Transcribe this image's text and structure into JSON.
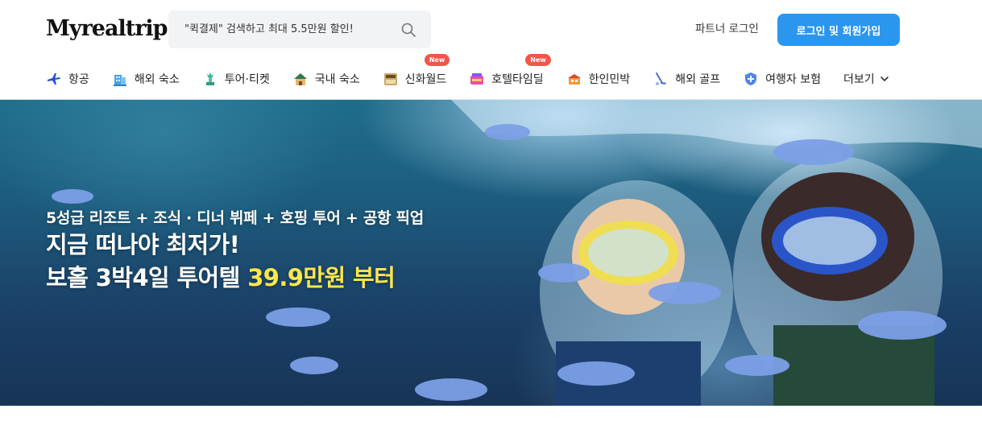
{
  "header": {
    "logo_text": "Myrealtrip",
    "search": {
      "placeholder": "\"퀵결제\" 검색하고 최대 5.5만원 할인!"
    },
    "partner_login": "파트너 로그인",
    "login_button": "로그인 및 회원가입"
  },
  "nav": {
    "items": [
      {
        "label": "항공",
        "icon": "airplane-icon"
      },
      {
        "label": "해외 숙소",
        "icon": "hotel-building-icon"
      },
      {
        "label": "투어·티켓",
        "icon": "statue-of-liberty-icon"
      },
      {
        "label": "국내 숙소",
        "icon": "house-icon"
      },
      {
        "label": "신화월드",
        "icon": "shinhwa-world-icon",
        "badge": "New"
      },
      {
        "label": "호텔타임딜",
        "icon": "time-deal-icon",
        "badge": "New"
      },
      {
        "label": "한인민박",
        "icon": "guesthouse-icon"
      },
      {
        "label": "해외 골프",
        "icon": "golf-icon"
      },
      {
        "label": "여행자 보험",
        "icon": "shield-icon"
      },
      {
        "label": "더보기",
        "icon": "chevron-down-icon"
      }
    ]
  },
  "hero": {
    "subtitle": "5성급 리조트 + 조식 · 디너 뷔페 + 호핑 투어 + 공항 픽업",
    "title_line1": "지금 떠나야 최저가!",
    "title_line2_prefix": "보홀 3박4일 투어텔 ",
    "title_line2_price": "39.9만원 부터"
  },
  "colors": {
    "accent": "#2b96ed",
    "badge": "#f0564a",
    "price_highlight": "#ffe64d"
  }
}
